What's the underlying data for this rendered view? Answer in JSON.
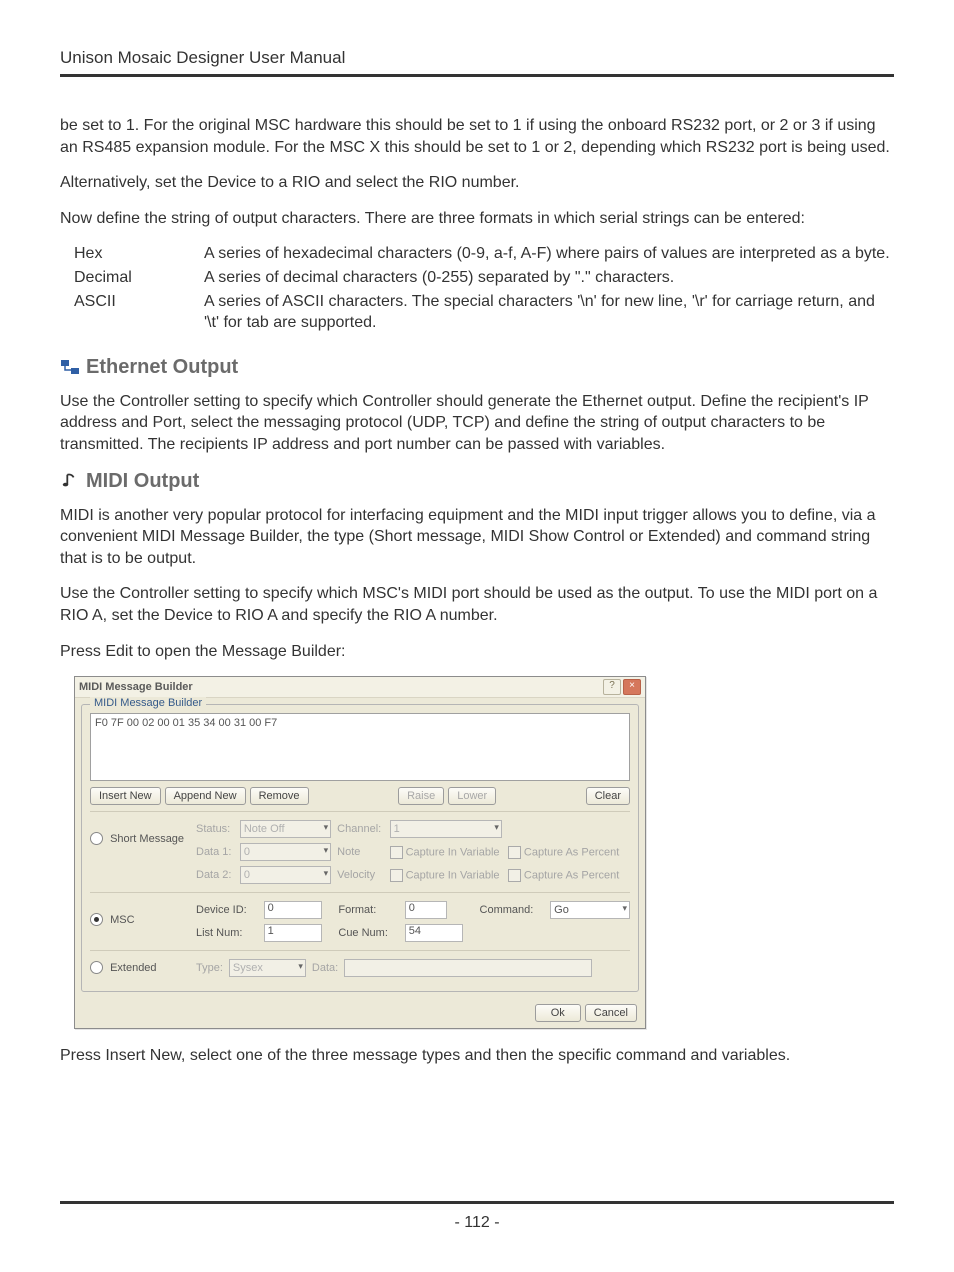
{
  "header": {
    "title": "Unison Mosaic Designer User Manual"
  },
  "intro": {
    "p1": "be set to 1. For the original MSC hardware this should be set to 1 if using the onboard RS232 port, or 2 or 3 if using an RS485 expansion module. For the MSC X this should be set to 1 or 2, depending which RS232 port is being used.",
    "p2": "Alternatively, set the Device to a RIO and select the RIO number.",
    "p3": "Now define the string of output characters. There are three formats in which serial strings can be entered:"
  },
  "formats": [
    {
      "term": "Hex",
      "desc": "A series of hexadecimal characters (0-9, a-f, A-F) where pairs of values are interpreted as a byte."
    },
    {
      "term": "Decimal",
      "desc": "A series of decimal characters (0-255) separated by \".\" characters."
    },
    {
      "term": "ASCII",
      "desc": "A series of ASCII characters. The special characters '\\n' for new line, '\\r' for carriage return, and '\\t' for tab are supported."
    }
  ],
  "ethernet": {
    "heading": "Ethernet Output",
    "body": "Use the Controller setting to specify which Controller should generate the Ethernet output. Define the recipient's IP address and Port, select the messaging protocol (UDP, TCP) and define the string of output characters to be transmitted. The recipients IP address and port number can be passed with variables."
  },
  "midi": {
    "heading": "MIDI Output",
    "p1": "MIDI is another very popular protocol for interfacing equipment and the MIDI input trigger allows you to define, via a convenient MIDI Message Builder, the type (Short message, MIDI Show Control or Extended) and command string that is to be output.",
    "p2": "Use the Controller setting to specify which MSC's MIDI port should be used as the output. To use the MIDI port on a RIO A, set the Device to RIO A and specify the RIO A number.",
    "p3": "Press Edit to open the Message Builder:"
  },
  "dialog": {
    "title": "MIDI Message Builder",
    "help": "?",
    "close": "×",
    "group_legend": "MIDI Message Builder",
    "hex_string": "F0 7F 00 02 00 01 35 34 00 31 00 F7",
    "buttons": {
      "insert": "Insert New",
      "append": "Append New",
      "remove": "Remove",
      "raise": "Raise",
      "lower": "Lower",
      "clear": "Clear"
    },
    "short": {
      "radio": "Short Message",
      "status_label": "Status:",
      "status_value": "Note Off",
      "channel_label": "Channel:",
      "channel_value": "1",
      "d1_label": "Data 1:",
      "d1_value": "0",
      "d1_type": "Note",
      "d2_label": "Data 2:",
      "d2_value": "0",
      "d2_type": "Velocity",
      "civ": "Capture In Variable",
      "cap": "Capture As Percent"
    },
    "msc": {
      "radio": "MSC",
      "devid_label": "Device ID:",
      "devid_value": "0",
      "format_label": "Format:",
      "format_value": "0",
      "command_label": "Command:",
      "command_value": "Go",
      "listnum_label": "List Num:",
      "listnum_value": "1",
      "cuenum_label": "Cue Num:",
      "cuenum_value": "54"
    },
    "extended": {
      "radio": "Extended",
      "type_label": "Type:",
      "type_value": "Sysex",
      "data_label": "Data:",
      "data_value": ""
    },
    "ok": "Ok",
    "cancel": "Cancel"
  },
  "after_dialog": "Press Insert New, select one of the three message types and then the specific command and variables.",
  "page_number": "- 112 -"
}
